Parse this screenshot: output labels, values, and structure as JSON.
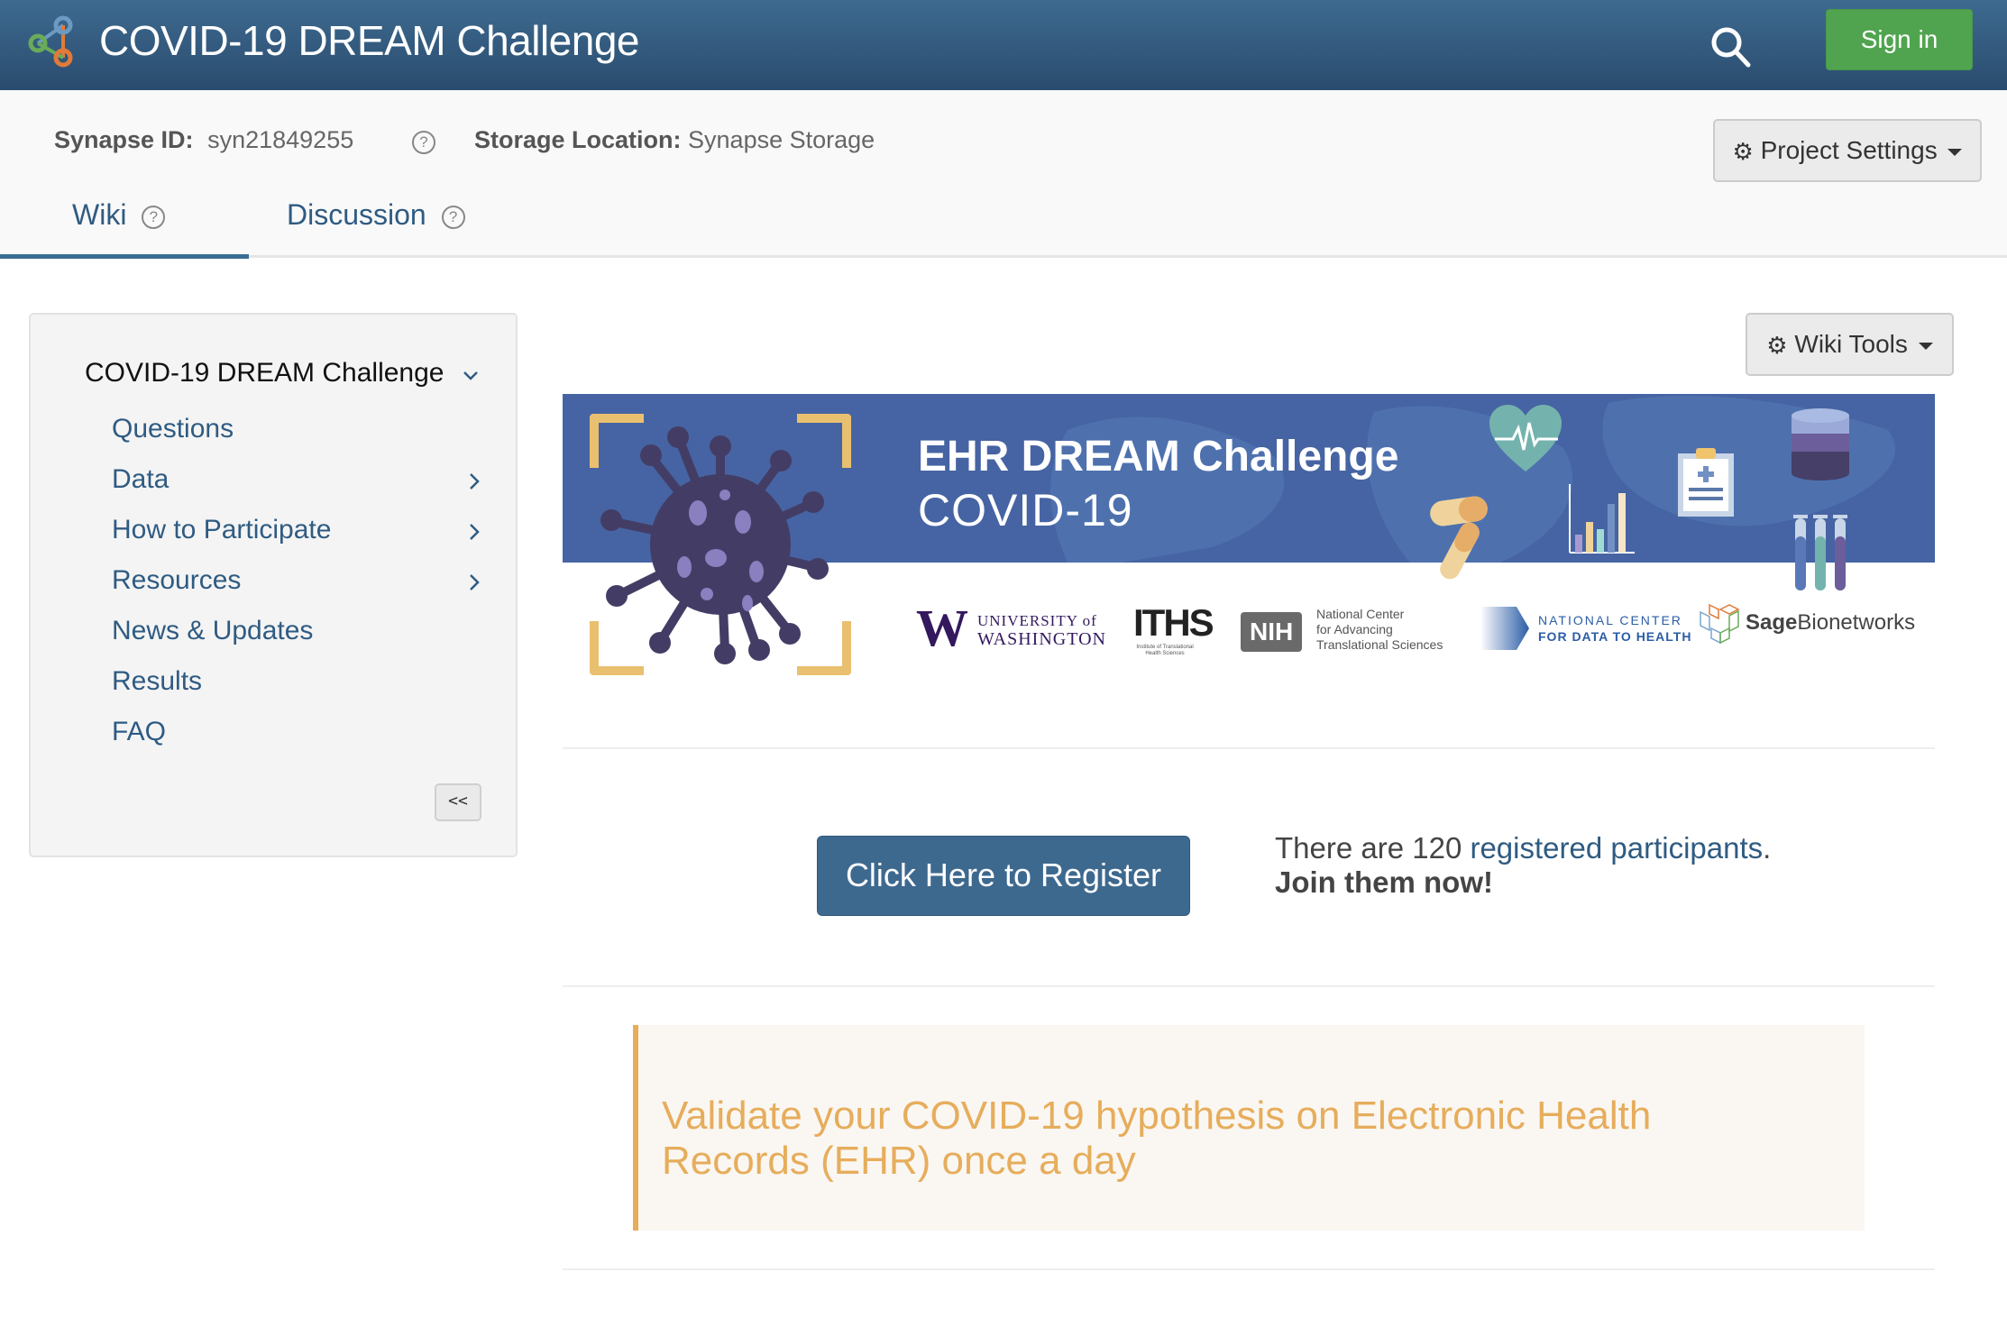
{
  "header": {
    "title": "COVID-19 DREAM Challenge",
    "search_icon": "search-icon",
    "sign_in_label": "Sign in"
  },
  "meta": {
    "synapse_id_label": "Synapse ID:",
    "synapse_id_value": "syn21849255",
    "help_glyph": "?",
    "storage_label": "Storage Location:",
    "storage_value": "Synapse Storage",
    "project_settings_label": "Project Settings"
  },
  "tabs": [
    {
      "label": "Wiki",
      "active": true
    },
    {
      "label": "Discussion",
      "active": false
    }
  ],
  "sidebar": {
    "root": "COVID-19 DREAM Challenge",
    "items": [
      {
        "label": "Questions",
        "has_children": false
      },
      {
        "label": "Data",
        "has_children": true
      },
      {
        "label": "How to Participate",
        "has_children": true
      },
      {
        "label": "Resources",
        "has_children": true
      },
      {
        "label": "News & Updates",
        "has_children": false
      },
      {
        "label": "Results",
        "has_children": false
      },
      {
        "label": "FAQ",
        "has_children": false
      }
    ],
    "collapse_label": "<<"
  },
  "wiki_tools_label": "Wiki Tools",
  "banner": {
    "title": "EHR DREAM Challenge",
    "subtitle": "COVID-19",
    "logos": {
      "uw_line1": "UNIVERSITY of",
      "uw_line2": "WASHINGTON",
      "iths": "ITHS",
      "iths_sub": "Institute of Translational Health Sciences",
      "nih": "NIH",
      "ncats_line1": "National Center",
      "ncats_line2": "for Advancing",
      "ncats_line3": "Translational Sciences",
      "ncdh_line1": "NATIONAL CENTER",
      "ncdh_line2": "FOR DATA TO HEALTH",
      "sage_bold": "Sage",
      "sage_rest": "Bionetworks"
    }
  },
  "register": {
    "button_label": "Click Here to Register",
    "text_prefix": "There are 120 ",
    "link_label": "registered participants",
    "text_suffix": ".",
    "join_label": "Join them now!"
  },
  "callout": {
    "text": "Validate your COVID-19 hypothesis on Electronic Health Records (EHR) once a day"
  },
  "colors": {
    "header_top": "#3e6a90",
    "header_bottom": "#2a4c6e",
    "sign_in": "#51a44f",
    "link": "#2f5b82",
    "banner_blue": "#4664a3",
    "callout_accent": "#e6ad5c"
  }
}
